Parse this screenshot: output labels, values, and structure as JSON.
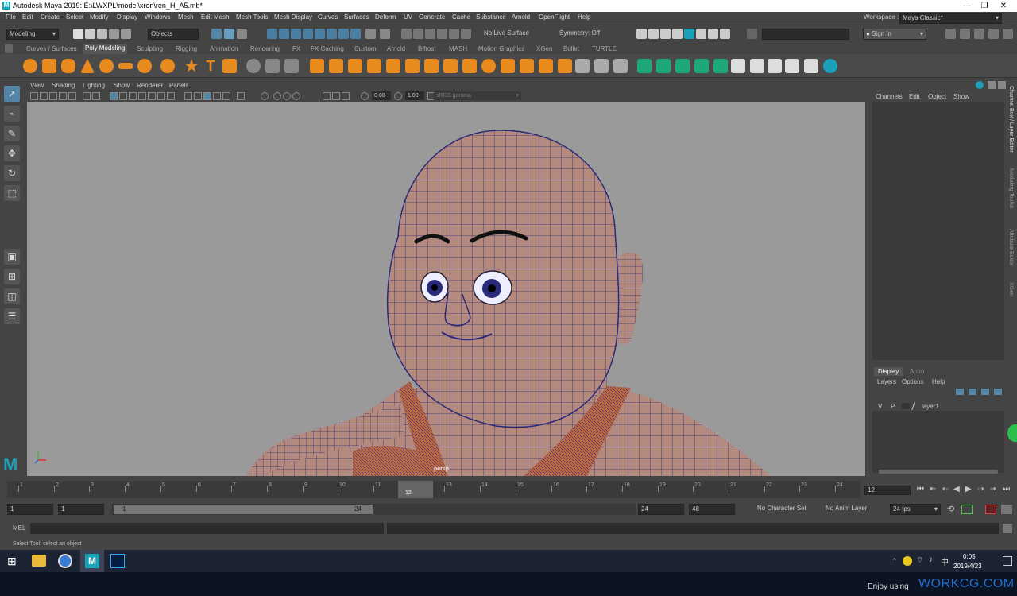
{
  "window": {
    "title": "Autodesk Maya 2019: E:\\LWXPL\\model\\xren\\ren_H_A5.mb*",
    "logo_letter": "M",
    "minimize_glyph": "—",
    "maximize_glyph": "❐",
    "close_glyph": "✕"
  },
  "menubar": {
    "items": [
      "File",
      "Edit",
      "Create",
      "Select",
      "Modify",
      "Display",
      "Windows",
      "Mesh",
      "Edit Mesh",
      "Mesh Tools",
      "Mesh Display",
      "Curves",
      "Surfaces",
      "Deform",
      "UV",
      "Generate",
      "Cache",
      "Substance",
      "Arnold",
      "OpenFlight",
      "Help"
    ],
    "workspace_label": "Workspace :",
    "workspace_value": "Maya Classic*"
  },
  "statusline": {
    "menuset": "Modeling",
    "objects_label": "Objects",
    "live_surface": "No Live Surface",
    "symmetry": "Symmetry: Off",
    "sign_in": "Sign In"
  },
  "shelf": {
    "tabs": [
      "Curves / Surfaces",
      "Poly Modeling",
      "Sculpting",
      "Rigging",
      "Animation",
      "Rendering",
      "FX",
      "FX Caching",
      "Custom",
      "Arnold",
      "Bifrost",
      "MASH",
      "Motion Graphics",
      "XGen",
      "Bullet",
      "TURTLE"
    ],
    "active_tab": "Poly Modeling"
  },
  "viewport": {
    "menu": [
      "View",
      "Shading",
      "Lighting",
      "Show",
      "Renderer",
      "Panels"
    ],
    "exposure": "0.00",
    "gamma": "1.00",
    "color_space": "sRGB gamma",
    "camera_label": "persp"
  },
  "channel_box": {
    "menu": [
      "Channels",
      "Edit",
      "Object",
      "Show"
    ]
  },
  "layer_editor": {
    "tabs": [
      "Display",
      "Anim"
    ],
    "menu": [
      "Layers",
      "Options",
      "Help"
    ],
    "layer_v": "V",
    "layer_p": "P",
    "layer_name": "layer1"
  },
  "side_tabs": [
    "Channel Box / Layer Editor",
    "Modeling Toolkit",
    "Attribute Editor",
    "XGen"
  ],
  "timeline": {
    "ticks": [
      "1",
      "2",
      "3",
      "4",
      "5",
      "6",
      "7",
      "8",
      "9",
      "10",
      "11",
      "12",
      "13",
      "14",
      "15",
      "16",
      "17",
      "18",
      "19",
      "20",
      "21",
      "22",
      "23",
      "24"
    ],
    "current_frame": "12",
    "current_frame_field": "12"
  },
  "range": {
    "start": "1",
    "start_inner": "1",
    "slider_start": "1",
    "slider_end": "24",
    "end_inner": "24",
    "end": "48",
    "character_set": "No Character Set",
    "anim_layer": "No Anim Layer",
    "fps": "24 fps"
  },
  "mel": {
    "label": "MEL"
  },
  "helpline": {
    "text": "Select Tool: select an object"
  },
  "taskbar": {
    "time": "0:05",
    "date": "2019/4/23",
    "ime": "中"
  },
  "watermark": {
    "prefix": "Enjoy using",
    "brand": "WORKCG.COM"
  },
  "colors": {
    "accent": "#5285a6",
    "skin": "#b58a7e",
    "wire": "#2a2a7a",
    "brand": "#1e6fd0"
  }
}
